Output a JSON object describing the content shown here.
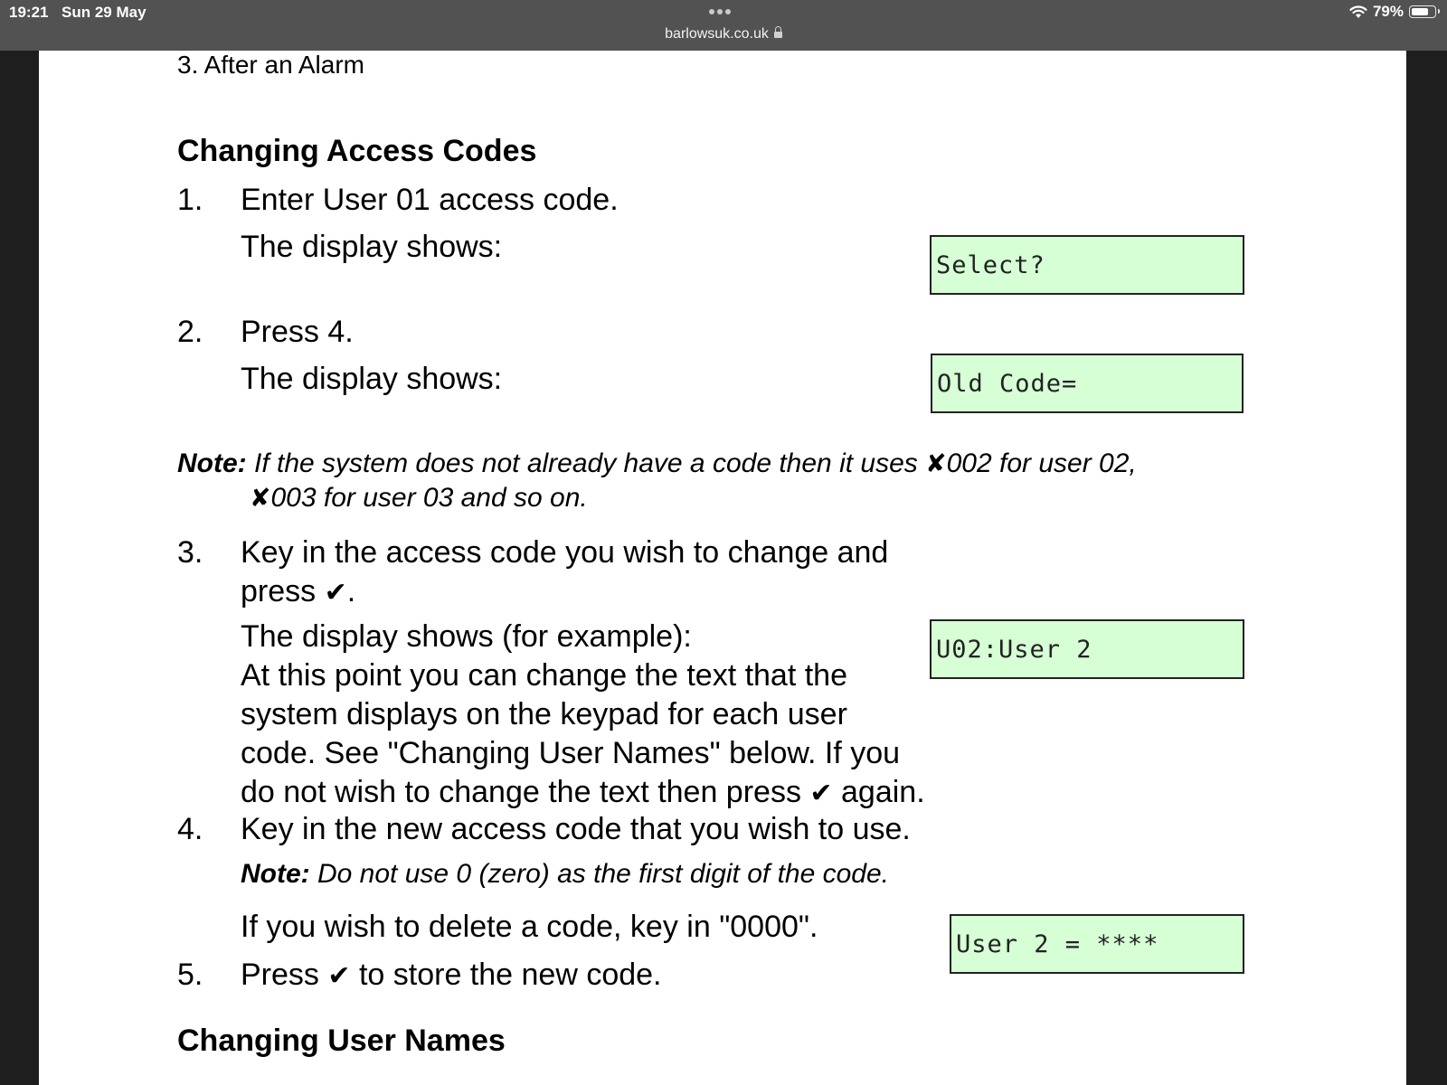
{
  "status_bar": {
    "time": "19:21",
    "date": "Sun 29 May",
    "url": "barlowsuk.co.uk",
    "battery": "79%",
    "battery_level": 0.79
  },
  "document": {
    "previous_item": "3. After an Alarm",
    "section_title": "Changing Access Codes",
    "next_section_title": "Changing User Names",
    "display_shows": "The display shows:",
    "steps": [
      {
        "num": "1.",
        "text": "Enter User 01 access code."
      },
      {
        "num": "2.",
        "text": "Press 4."
      },
      {
        "num": "3.",
        "line1": "Key in the access code you wish to change and",
        "line2_pre": "press",
        "line2_post": "."
      },
      {
        "num": "4.",
        "text": "Key in the new access code that you wish to use."
      },
      {
        "num": "5.",
        "pre": "Press",
        "post": "to store the new code."
      }
    ],
    "note1": {
      "label": "Note:",
      "line1_pre": "If the system does not already have a code then it uses",
      "line1_post": "002 for user 02,",
      "line2_post": "003 for user 03 and so on."
    },
    "step3_detail": {
      "line1": "The display shows (for example):",
      "line2": "At this point you can change the text that the",
      "line3": "system displays on the keypad for each user",
      "line4": "code. See \"Changing User Names\" below. If you",
      "line5_pre": "do not wish to change the text then press",
      "line5_post": "again."
    },
    "note2": {
      "label": "Note:",
      "text": "Do not use 0 (zero) as the first digit of the code."
    },
    "delete_code": "If you wish to delete a code, key in \"0000\".",
    "symbols": {
      "check": "✔",
      "cross": "✘"
    },
    "lcd_displays": [
      "Select?",
      "Old Code=",
      "U02:User 2",
      "User 2 = ****"
    ]
  }
}
